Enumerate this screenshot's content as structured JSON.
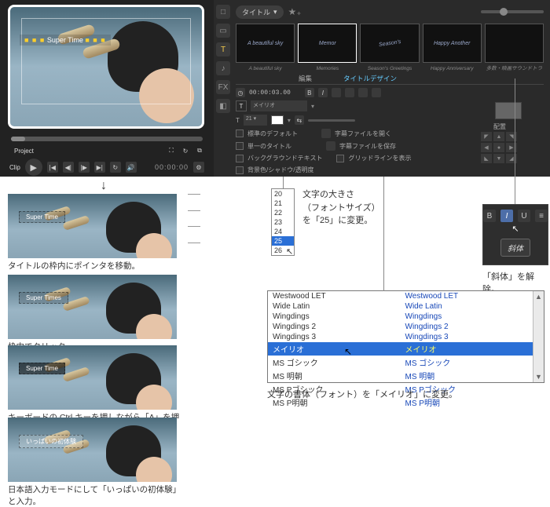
{
  "preview": {
    "title_text": "Super Time",
    "dots": "■ ■ ■"
  },
  "transport": {
    "project_label": "Project",
    "clip_label": "Clip",
    "timecode": "00:00:00",
    "icons": {
      "fullscreen": "⛶",
      "loop": "↻",
      "detach": "⧉"
    }
  },
  "right": {
    "category": "タイトル",
    "thumbs": [
      {
        "text": "A beautiful sky",
        "caption": "A beautiful sky"
      },
      {
        "text": "Memor",
        "caption": "Memories"
      },
      {
        "text": "Season's",
        "caption": "Season's Greetings"
      },
      {
        "text": "Happy Another",
        "caption": "Happy Anniversary"
      },
      {
        "text": "",
        "caption": "多数・映画サウンドトラ"
      }
    ],
    "tabs": {
      "edit": "編集",
      "title_design": "タイトルデザイン"
    },
    "props": {
      "timecode": "00:00:03.00",
      "font_field": "メイリオ",
      "size_dd": "21 ▾",
      "place_label": "配置",
      "opts": {
        "a": "標準のデフォルト",
        "b": "単一のタイトル",
        "c": "バックグラウンドテキスト",
        "d": "背景色/シャドウ/透明度",
        "e": "字幕ファイルを開く",
        "f": "字幕ファイルを保存",
        "g": "グリッドラインを表示"
      }
    }
  },
  "leftbar": {
    "i1": "□",
    "i2": "▭",
    "i3": "T",
    "i4": "♪",
    "i5": "FX",
    "i6": "◧"
  },
  "sizes": {
    "list": [
      "20",
      "21",
      "22",
      "23",
      "24",
      "25",
      "26"
    ],
    "selected": "25"
  },
  "size_text": {
    "l1": "文字の大きさ",
    "l2": "（フォントサイズ）",
    "l3": "を「25」に変更。"
  },
  "bi": {
    "B": "B",
    "I": "I",
    "U": "U",
    "menu": "≡",
    "chip": "斜体",
    "caption": "「斜体」を解除。"
  },
  "fonts": {
    "left": [
      "Westwood LET",
      "Wide Latin",
      "Wingdings",
      "Wingdings 2",
      "Wingdings 3",
      "メイリオ",
      "MS ゴシック",
      "MS 明朝",
      "MS Pゴシック",
      "MS P明朝"
    ],
    "right": [
      "Westwood LET",
      "Wide Latin",
      "Wingdings",
      "Wingdings 2",
      "Wingdings 3",
      "メイリオ",
      "MS ゴシック",
      "MS 明朝",
      "MS Pゴシック",
      "MS P明朝"
    ],
    "selected": "メイリオ",
    "caption": "文字の書体（フォント）を「メイリオ」に変更。"
  },
  "steps": {
    "s1": {
      "box": "Super Time",
      "caption": "タイトルの枠内にポインタを移動。"
    },
    "s2": {
      "box": "Super Times",
      "caption": "枠内でクリック。"
    },
    "s3": {
      "box": "Super Time",
      "caption": "キーボードの Ctrl キーを押しながら「A」を押す。"
    },
    "s4": {
      "box": "いっぱいの初体験",
      "caption": "日本語入力モードにして「いっぱいの初体験」と入力。"
    }
  }
}
